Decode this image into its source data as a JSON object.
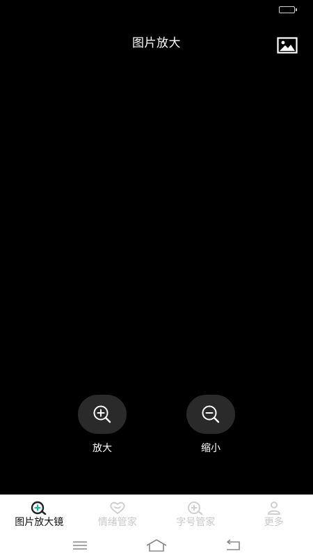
{
  "header": {
    "title": "图片放大",
    "gallery_icon": "image-icon"
  },
  "controls": {
    "zoom_in": {
      "label": "放大",
      "icon": "zoom-in-icon"
    },
    "zoom_out": {
      "label": "缩小",
      "icon": "zoom-out-icon"
    }
  },
  "tabs": [
    {
      "label": "图片放大镜",
      "icon": "magnifier-plus-icon",
      "active": true
    },
    {
      "label": "情绪管家",
      "icon": "heart-smile-icon",
      "active": false
    },
    {
      "label": "字号管家",
      "icon": "font-zoom-icon",
      "active": false
    },
    {
      "label": "更多",
      "icon": "person-icon",
      "active": false
    }
  ],
  "system_nav": {
    "menu_icon": "menu-icon",
    "home_icon": "home-icon",
    "back_icon": "back-icon"
  },
  "colors": {
    "background": "#000000",
    "control_bg": "#2a2a2a",
    "tab_active_text": "#111111",
    "tab_inactive_text": "#c9c9c9",
    "accent_teal": "#1abc9c"
  }
}
